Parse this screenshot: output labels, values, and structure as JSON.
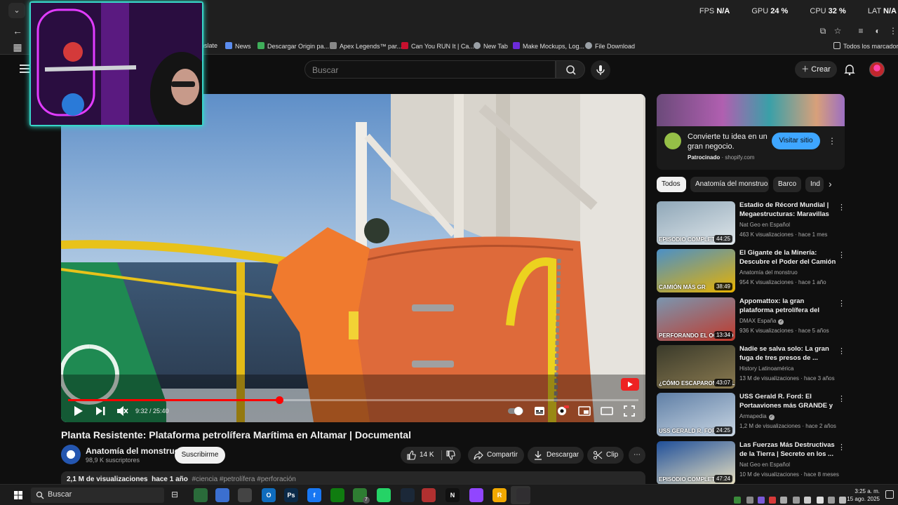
{
  "browser": {
    "perf": [
      {
        "label": "FPS",
        "value": "N/A"
      },
      {
        "label": "GPU",
        "value": "24 %"
      },
      {
        "label": "CPU",
        "value": "32 %"
      },
      {
        "label": "LAT",
        "value": "N/A"
      }
    ],
    "bookmarks": [
      {
        "label": "nslate",
        "color": "#4285f4"
      },
      {
        "label": "News",
        "color": "#5b8def"
      },
      {
        "label": "Descargar Origin pa...",
        "color": "#3fae5a"
      },
      {
        "label": "Apex Legends™ par...",
        "color": "#888888"
      },
      {
        "label": "Can You RUN It | Ca...",
        "color": "#c8102e"
      },
      {
        "label": "New Tab",
        "color": "#9aa0a6"
      },
      {
        "label": "Make Mockups, Log...",
        "color": "#6b2bd9"
      },
      {
        "label": "File Download",
        "color": "#9aa0a6"
      }
    ],
    "all_bookmarks": "Todos los marcadores"
  },
  "header": {
    "search_placeholder": "Buscar",
    "create_label": "Crear"
  },
  "player": {
    "progress": 0.37,
    "time": "9:32 / 25:40"
  },
  "video": {
    "title": "Planta Resistente: Plataforma petrolífera Marítima en Altamar | Documental",
    "channel": "Anatomía del monstruo",
    "subscribers": "98,9 K suscriptores",
    "subscribe_label": "Suscribirme",
    "likes": "14 K",
    "share_label": "Compartir",
    "download_label": "Descargar",
    "clip_label": "Clip",
    "views": "2,1 M de visualizaciones",
    "age": "hace 1 año",
    "tags": "#ciencia #petrolífera #perforación"
  },
  "ad": {
    "headline": "Convierte tu idea en un gran negocio.",
    "sponsored": "Patrocinado",
    "domain": "shopify.com",
    "cta": "Visitar sitio"
  },
  "chips": [
    "Todos",
    "Anatomía del monstruo",
    "Barco",
    "Ind"
  ],
  "recommendations": [
    {
      "title": "Estadio de Récord Mundial | Megaestructuras: Maravillas d...",
      "channel": "Nat Geo en Español",
      "meta": "463 K visualizaciones · hace 1 mes",
      "duration": "44:25",
      "caption": "EPISODIO COMPLETO",
      "verified": false,
      "c1": "#8fa7b8",
      "c2": "#dfe6ea"
    },
    {
      "title": "El Gigante de la Minería: Descubre el Poder del Camión ...",
      "channel": "Anatomía del monstruo",
      "meta": "954 K visualizaciones · hace 1 año",
      "duration": "38:49",
      "caption": "CAMIÓN MÁS GR",
      "verified": false,
      "c1": "#4a90c8",
      "c2": "#e8b200"
    },
    {
      "title": "Appomattox: la gran plataforma petrolífera del Golfo de México...",
      "channel": "DMAX España",
      "meta": "936 K visualizaciones · hace 5 años",
      "duration": "13:34",
      "caption": "PERFORANDO EL OCÉANO",
      "verified": true,
      "c1": "#7a96b0",
      "c2": "#c0392b"
    },
    {
      "title": "Nadie se salva solo: La gran fuga de tres presos de ...",
      "channel": "History Latinoamérica",
      "meta": "13 M de visualizaciones · hace 3 años",
      "duration": "43:07",
      "caption": "¿CÓMO ESCAPARON DE ALCATRAZ?",
      "verified": false,
      "c1": "#3a3a2a",
      "c2": "#8a7a50"
    },
    {
      "title": "USS Gerald R. Ford: El Portaaviones más GRANDE y ...",
      "channel": "Armapedia",
      "meta": "1,2 M de visualizaciones · hace 2 años",
      "duration": "24:25",
      "caption": "USS GERALD R. FORD",
      "verified": true,
      "c1": "#5f7fa6",
      "c2": "#c9d6e3"
    },
    {
      "title": "Las Fuerzas Más Destructivas de la Tierra | Secreto en los ...",
      "channel": "Nat Geo en Español",
      "meta": "10 M de visualizaciones · hace 8 meses",
      "duration": "47:24",
      "caption": "EPISODIO COMPLETO",
      "verified": false,
      "c1": "#1f4f9a",
      "c2": "#e8e0c0"
    }
  ],
  "taskbar": {
    "search_label": "Buscar",
    "apps": [
      {
        "name": "chrome-app",
        "glyph": "",
        "color": "#2a6b3a"
      },
      {
        "name": "store-app",
        "glyph": "",
        "color": "#3b6fd0"
      },
      {
        "name": "camera-app",
        "glyph": "",
        "color": "#444444"
      },
      {
        "name": "outlook-app",
        "glyph": "O",
        "color": "#0f6cbd"
      },
      {
        "name": "photoshop-app",
        "glyph": "Ps",
        "color": "#0b2a48"
      },
      {
        "name": "xbox-app",
        "glyph": "",
        "color": "#107c10"
      },
      {
        "name": "facebook-app",
        "glyph": "f",
        "color": "#1877f2"
      },
      {
        "name": "xbox-app-2",
        "glyph": "",
        "color": "#2e7d32"
      },
      {
        "name": "whatsapp-app",
        "glyph": "",
        "color": "#25d366"
      },
      {
        "name": "steam-app",
        "glyph": "",
        "color": "#1b2838"
      },
      {
        "name": "voicemeeter-app",
        "glyph": "",
        "color": "#b03030"
      },
      {
        "name": "netflix-app",
        "glyph": "N",
        "color": "#111111"
      },
      {
        "name": "twitch-app",
        "glyph": "",
        "color": "#9146ff"
      },
      {
        "name": "rockstar-app",
        "glyph": "R",
        "color": "#f2a900"
      },
      {
        "name": "obs-app",
        "glyph": "",
        "color": "#302e31"
      },
      {
        "name": "chrome-app-2",
        "glyph": "",
        "color": "#2a6b3a"
      }
    ],
    "whatsapp_badge": "7",
    "time": "3:25 a. m.",
    "date": "15 ago. 2025"
  }
}
